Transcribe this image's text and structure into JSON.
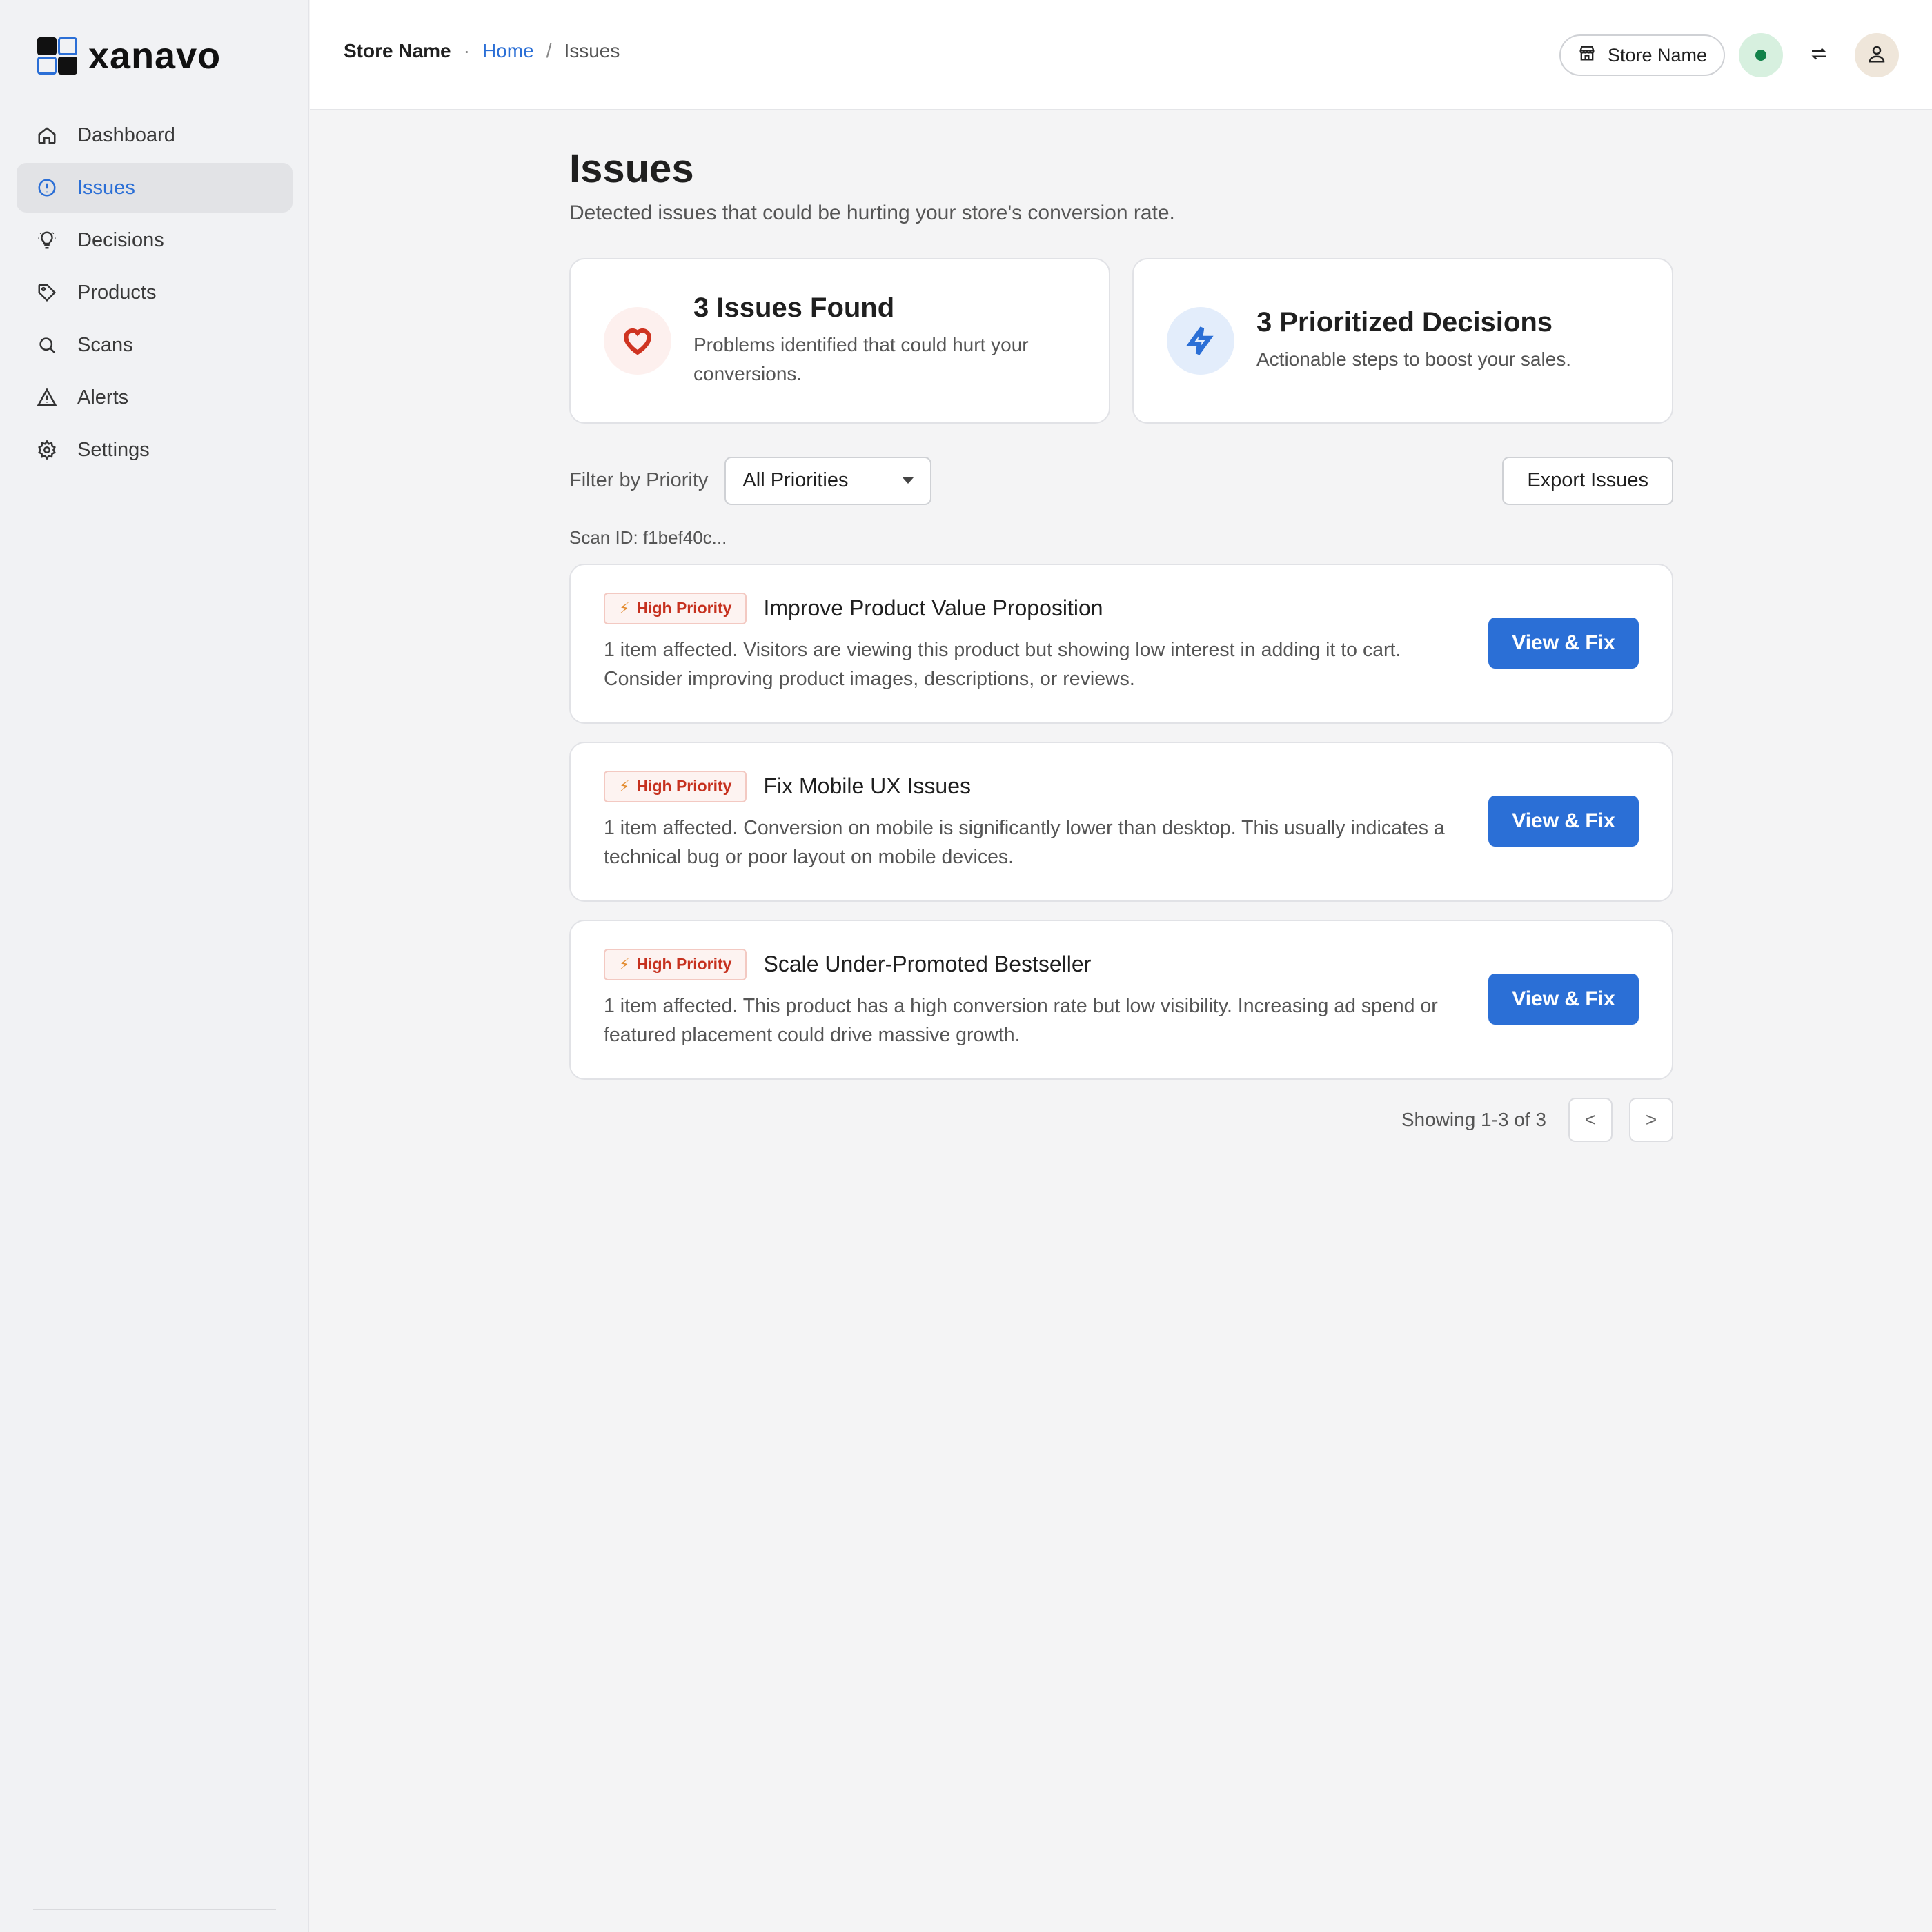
{
  "brand": {
    "name": "xanavo"
  },
  "sidebar": {
    "items": [
      {
        "label": "Dashboard",
        "icon": "home-icon"
      },
      {
        "label": "Issues",
        "icon": "alert-circle-icon"
      },
      {
        "label": "Decisions",
        "icon": "lightbulb-icon"
      },
      {
        "label": "Products",
        "icon": "tag-icon"
      },
      {
        "label": "Scans",
        "icon": "search-icon"
      },
      {
        "label": "Alerts",
        "icon": "warning-triangle-icon"
      },
      {
        "label": "Settings",
        "icon": "gear-icon"
      }
    ],
    "active": "Issues"
  },
  "header": {
    "store_name": "Store Name",
    "separator": "·",
    "breadcrumb": {
      "home": "Home",
      "sep": "/",
      "current": "Issues"
    },
    "store_pill_label": "Store Name"
  },
  "page": {
    "title": "Issues",
    "subtitle": "Detected issues that could be hurting your store's conversion rate."
  },
  "stats": [
    {
      "title": "3 Issues Found",
      "desc": "Problems identified that could hurt your conversions.",
      "icon": "heart-icon"
    },
    {
      "title": "3 Prioritized Decisions",
      "desc": "Actionable steps to boost your sales.",
      "icon": "lightning-icon"
    }
  ],
  "filter": {
    "label": "Filter by Priority",
    "selected": "All Priorities",
    "export_label": "Export Issues"
  },
  "scan_id": "Scan ID: f1bef40c...",
  "issues": [
    {
      "priority": "High Priority",
      "title": "Improve Product Value Proposition",
      "desc": "1 item affected. Visitors are viewing this product but showing low interest in adding it to cart. Consider improving product images, descriptions, or reviews.",
      "action": "View & Fix"
    },
    {
      "priority": "High Priority",
      "title": "Fix Mobile UX Issues",
      "desc": "1 item affected. Conversion on mobile is significantly lower than desktop. This usually indicates a technical bug or poor layout on mobile devices.",
      "action": "View & Fix"
    },
    {
      "priority": "High Priority",
      "title": "Scale Under-Promoted Bestseller",
      "desc": "1 item affected. This product has a high conversion rate but low visibility. Increasing ad spend or featured placement could drive massive growth.",
      "action": "View & Fix"
    }
  ],
  "pagination": {
    "info": "Showing 1-3 of 3",
    "prev": "<",
    "next": ">"
  },
  "colors": {
    "accent": "#2b6fd6",
    "danger": "#c6311f",
    "status_online": "#12824a"
  }
}
